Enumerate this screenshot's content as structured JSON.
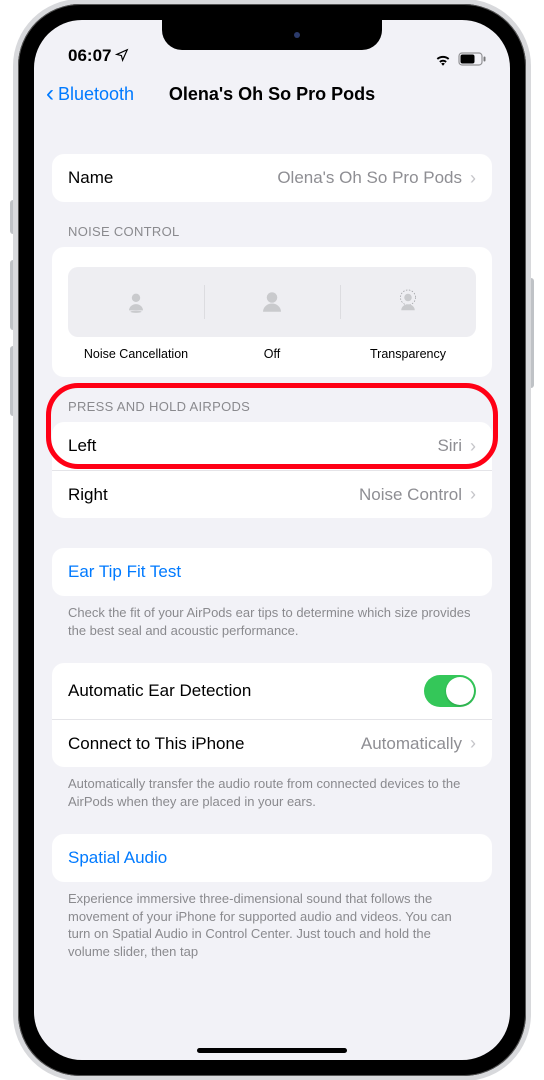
{
  "status": {
    "time": "06:07",
    "location_icon": "paperplane"
  },
  "nav": {
    "back_label": "Bluetooth",
    "title": "Olena's Oh So Pro Pods"
  },
  "name_row": {
    "label": "Name",
    "value": "Olena's Oh So Pro Pods"
  },
  "noise_control": {
    "header": "NOISE CONTROL",
    "options": {
      "cancel": "Noise Cancellation",
      "off": "Off",
      "trans": "Transparency"
    }
  },
  "press_hold": {
    "header": "PRESS AND HOLD AIRPODS",
    "left_label": "Left",
    "left_value": "Siri",
    "right_label": "Right",
    "right_value": "Noise Control"
  },
  "eartip": {
    "label": "Ear Tip Fit Test",
    "footer": "Check the fit of your AirPods ear tips to determine which size provides the best seal and acoustic performance."
  },
  "auto": {
    "ear_label": "Automatic Ear Detection",
    "connect_label": "Connect to This iPhone",
    "connect_value": "Automatically",
    "footer": "Automatically transfer the audio route from connected devices to the AirPods when they are placed in your ears."
  },
  "spatial": {
    "label": "Spatial Audio",
    "footer": "Experience immersive three-dimensional sound that follows the movement of your iPhone for supported audio and videos. You can turn on Spatial Audio in Control Center. Just touch and hold the volume slider, then tap"
  }
}
